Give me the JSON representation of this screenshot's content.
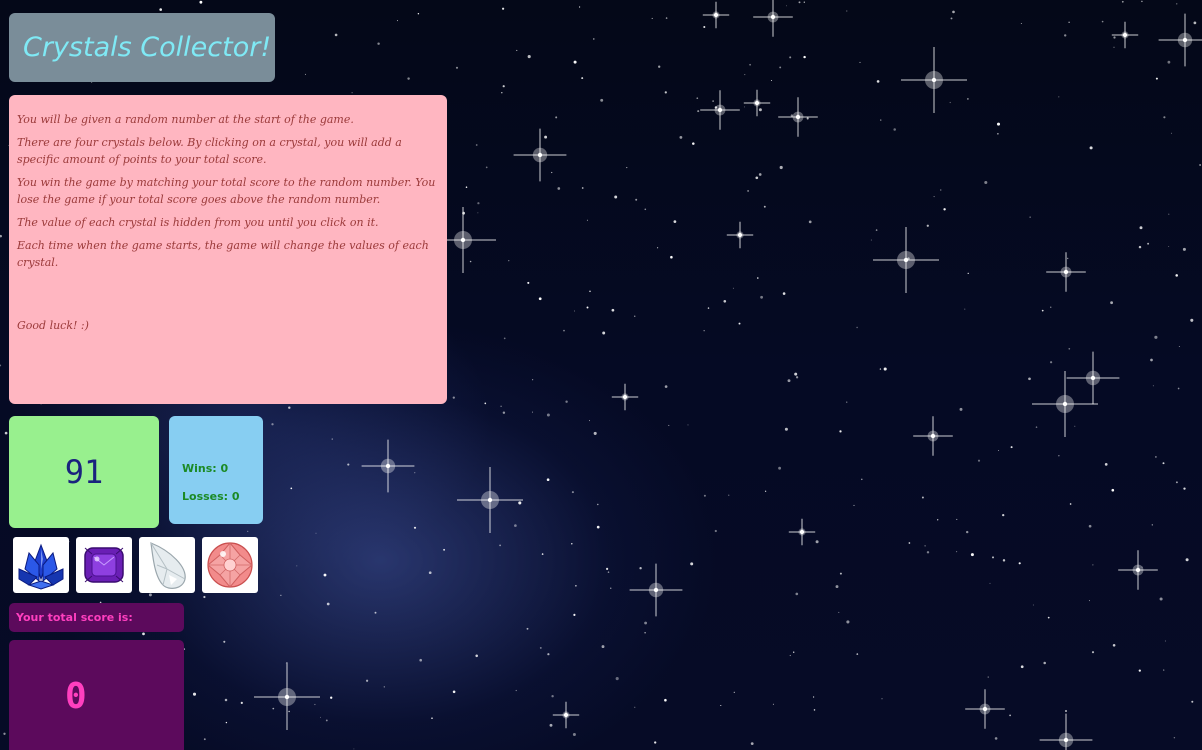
{
  "header": {
    "title": "Crystals Collector!"
  },
  "instructions": {
    "paragraphs": [
      "You will be given a random number at the start of the game.",
      "There are four crystals below. By clicking on a crystal, you will add a specific amount of points to your total score.",
      "You win the game by matching your total score to the random number. You lose the game if your total score goes above the random number.",
      "The value of each crystal is hidden from you until you click on it.",
      "Each time when the game starts, the game will change the values of each crystal."
    ],
    "closing": "Good luck! :)"
  },
  "game": {
    "target_number": "91",
    "wins_label": "Wins: 0",
    "losses_label": "Losses: 0",
    "score_label": "Your total score is:",
    "total_score": "0"
  },
  "crystals": [
    {
      "name": "blue-lotus-crystal",
      "color": "#1e3fcf"
    },
    {
      "name": "purple-square-crystal",
      "color": "#7a2fc4"
    },
    {
      "name": "clear-teardrop-crystal",
      "color": "#dfe6ea"
    },
    {
      "name": "pink-round-crystal",
      "color": "#f07a7a"
    }
  ],
  "colors": {
    "title_bg": "#7a8d99",
    "title_text": "#7fe9f5",
    "instructions_bg": "#ffb6c1",
    "target_bg": "#98f08e",
    "stats_bg": "#87cef2",
    "score_bg": "#5c0a5c",
    "score_text": "#ff3fbf"
  }
}
